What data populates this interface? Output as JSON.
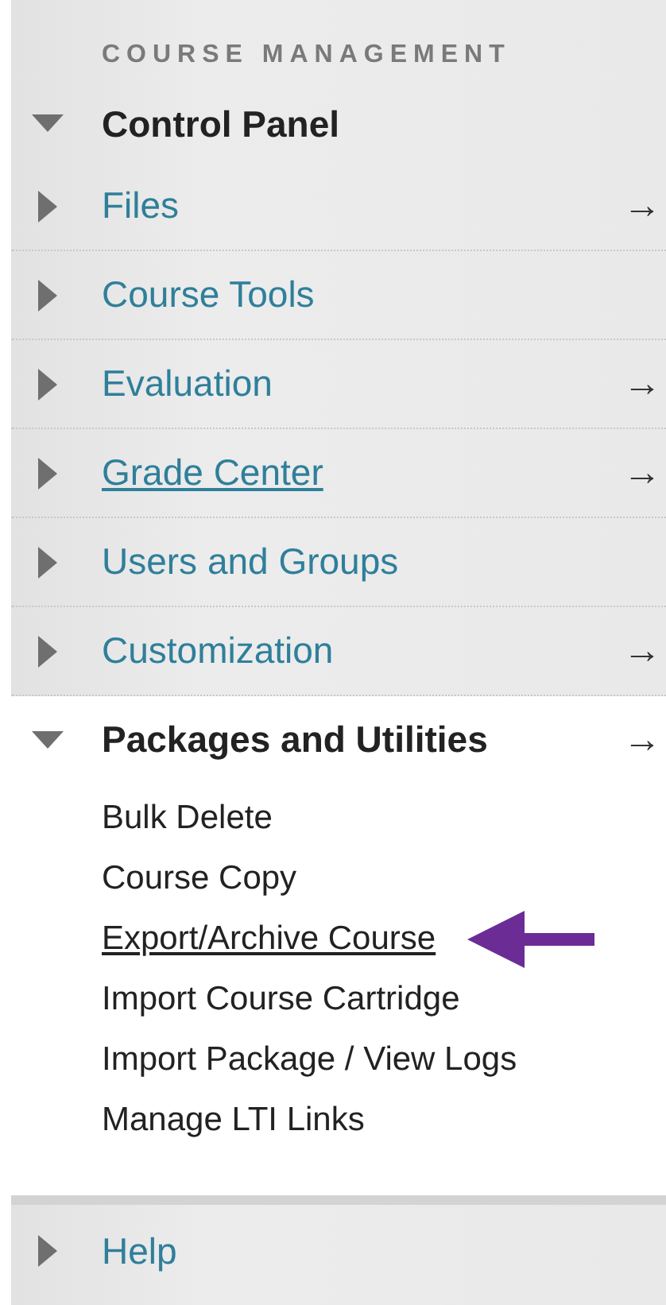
{
  "heading": "COURSE MANAGEMENT",
  "menu": [
    {
      "label": "Control Panel",
      "expanded": true,
      "children": [
        {
          "label": "Files",
          "expanded": false,
          "arrow": "→",
          "underlined": false
        },
        {
          "label": "Course Tools",
          "expanded": false,
          "underlined": false
        },
        {
          "label": "Evaluation",
          "expanded": false,
          "arrow": "→",
          "underlined": false
        },
        {
          "label": "Grade Center",
          "expanded": false,
          "arrow": "→",
          "underlined": true
        },
        {
          "label": "Users and Groups",
          "expanded": false,
          "underlined": false
        },
        {
          "label": "Customization",
          "expanded": false,
          "arrow": "→",
          "underlined": false
        },
        {
          "label": "Packages and Utilities",
          "expanded": true,
          "arrow": "→",
          "underlined": false,
          "children": [
            {
              "label": "Bulk Delete",
              "underlined": false,
              "highlighted": false
            },
            {
              "label": "Course Copy",
              "underlined": false,
              "highlighted": false
            },
            {
              "label": "Export/Archive Course",
              "underlined": true,
              "highlighted": true
            },
            {
              "label": "Import Course Cartridge",
              "underlined": false,
              "highlighted": false
            },
            {
              "label": "Import Package / View Logs",
              "underlined": false,
              "highlighted": false
            },
            {
              "label": "Manage LTI Links",
              "underlined": false,
              "highlighted": false
            }
          ]
        }
      ]
    },
    {
      "label": "Help",
      "expanded": false
    }
  ]
}
